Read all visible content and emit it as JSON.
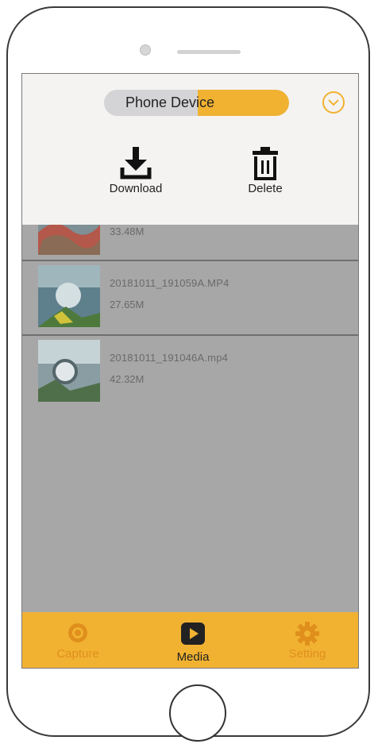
{
  "header": {
    "toggle_label": "Phone Device"
  },
  "actions": {
    "download_label": "Download",
    "delete_label": "Delete"
  },
  "media_list": {
    "items": [
      {
        "filename": "",
        "size": "33.48M"
      },
      {
        "filename": "20181011_191059A.MP4",
        "size": "27.65M"
      },
      {
        "filename": "20181011_191046A.mp4",
        "size": "42.32M"
      }
    ]
  },
  "tabbar": {
    "tabs": [
      {
        "label": "Capture",
        "icon": "capture-icon",
        "active": false
      },
      {
        "label": "Media",
        "icon": "media-play-icon",
        "active": true
      },
      {
        "label": "Setting",
        "icon": "gear-icon",
        "active": false
      }
    ]
  },
  "colors": {
    "accent": "#f1b232",
    "overlay": "#a7a7a7",
    "panel": "#f4f3f1"
  }
}
